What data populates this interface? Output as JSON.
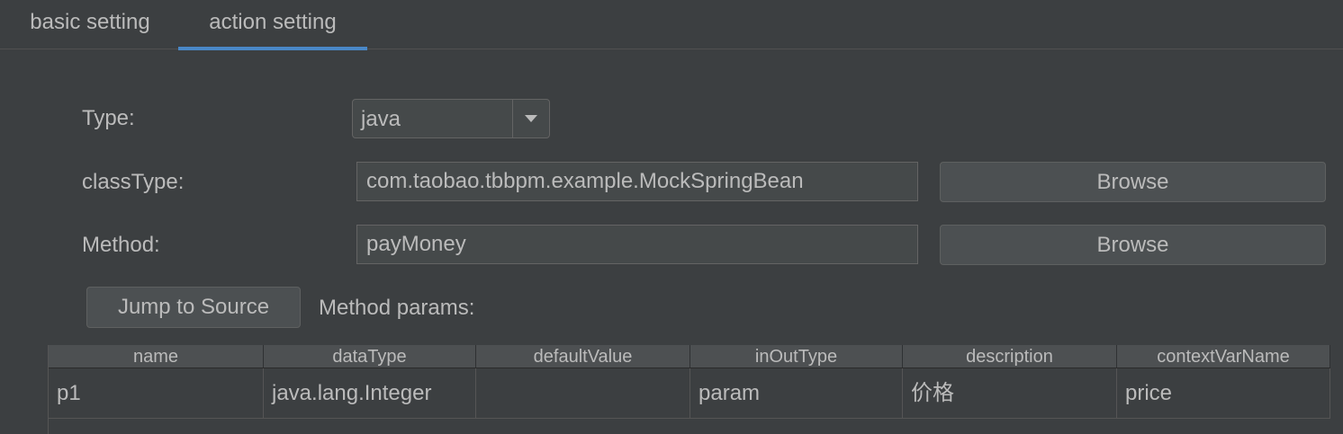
{
  "tabs": [
    {
      "label": "basic setting",
      "active": false
    },
    {
      "label": "action setting",
      "active": true
    }
  ],
  "form": {
    "type_label": "Type:",
    "type_value": "java",
    "class_type_label": "classType:",
    "class_type_value": "com.taobao.tbbpm.example.MockSpringBean",
    "method_label": "Method:",
    "method_value": "payMoney",
    "browse_label": "Browse",
    "jump_label": "Jump to Source",
    "method_params_label": "Method params:"
  },
  "table": {
    "columns": [
      "name",
      "dataType",
      "defaultValue",
      "inOutType",
      "description",
      "contextVarName"
    ],
    "rows": [
      [
        "p1",
        "java.lang.Integer",
        "",
        "param",
        "价格",
        "price"
      ]
    ]
  },
  "colors": {
    "background": "#3c3f41",
    "text": "#bbbbbb",
    "accent": "#4a88c7",
    "field_bg": "#45494a",
    "button_bg": "#4c5052",
    "header_bg": "#4d5052"
  },
  "icons": {
    "combo_arrow": "chevron-down-icon"
  }
}
